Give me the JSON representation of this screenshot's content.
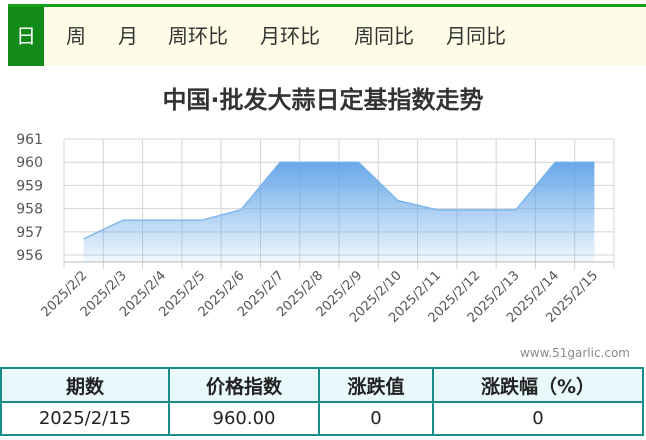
{
  "tabs": [
    "日",
    "周",
    "月",
    "周环比",
    "月环比",
    "周同比",
    "月同比"
  ],
  "active_tab": "日",
  "chart_data": {
    "type": "area",
    "title": "中国·批发大蒜日定基指数走势",
    "x": [
      "2025/2/2",
      "2025/2/3",
      "2025/2/4",
      "2025/2/5",
      "2025/2/6",
      "2025/2/7",
      "2025/2/8",
      "2025/2/9",
      "2025/2/10",
      "2025/2/11",
      "2025/2/12",
      "2025/2/13",
      "2025/2/14",
      "2025/2/15"
    ],
    "values": [
      956.7,
      957.5,
      957.5,
      957.5,
      957.95,
      960.0,
      960.0,
      960.0,
      958.35,
      957.95,
      957.95,
      957.95,
      960.0,
      960.0
    ],
    "y_ticks": [
      "956",
      "957",
      "958",
      "959",
      "960",
      "961"
    ],
    "ylim": [
      955.7,
      961
    ],
    "grid": true,
    "color": "#79b4ea"
  },
  "watermark": "www.51garlic.com",
  "table": {
    "headers": [
      "期数",
      "价格指数",
      "涨跌值",
      "涨跌幅（%）"
    ],
    "row": [
      "2025/2/15",
      "960.00",
      "0",
      "0"
    ]
  }
}
